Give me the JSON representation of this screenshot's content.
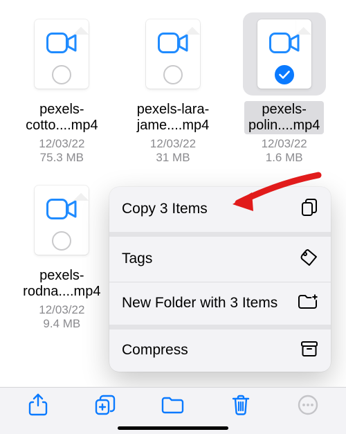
{
  "colors": {
    "accent": "#0a7aff",
    "muted": "#8a8a8e",
    "arrow": "#e11b1b"
  },
  "files": [
    {
      "name_line1": "pexels-",
      "name_line2": "cotto....mp4",
      "date": "12/03/22",
      "size": "75.3 MB",
      "selected": false
    },
    {
      "name_line1": "pexels-lara-",
      "name_line2": "jame....mp4",
      "date": "12/03/22",
      "size": "31 MB",
      "selected": false
    },
    {
      "name_line1": "pexels-",
      "name_line2": "polin....mp4",
      "date": "12/03/22",
      "size": "1.6 MB",
      "selected": true
    },
    {
      "name_line1": "pexels-",
      "name_line2": "rodna....mp4",
      "date": "12/03/22",
      "size": "9.4 MB",
      "selected": false
    }
  ],
  "context_menu": {
    "copy": "Copy 3 Items",
    "tags": "Tags",
    "new_folder": "New Folder with 3 Items",
    "compress": "Compress"
  },
  "toolbar": {
    "share": "share",
    "add": "duplicate",
    "folder": "folder",
    "trash": "trash",
    "more": "more"
  }
}
